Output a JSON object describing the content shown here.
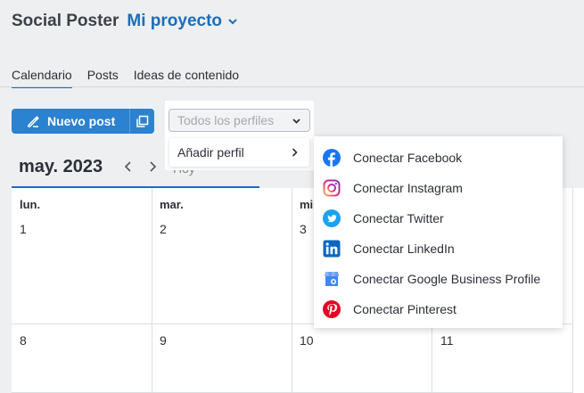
{
  "header": {
    "app_title": "Social Poster",
    "project_name": "Mi proyecto"
  },
  "tabs": [
    {
      "label": "Calendario",
      "active": true
    },
    {
      "label": "Posts",
      "active": false
    },
    {
      "label": "Ideas de contenido",
      "active": false
    }
  ],
  "toolbar": {
    "new_post_label": "Nuevo post",
    "profiles_placeholder": "Todos los perfiles",
    "add_profile_label": "Añadir perfil"
  },
  "calendar": {
    "month_label": "may. 2023",
    "today_label": "Hoy",
    "weekdays": [
      "lun.",
      "mar.",
      "mi"
    ],
    "week1_days": [
      "1",
      "2",
      "3"
    ],
    "week2_days": [
      "8",
      "9",
      "10",
      "11"
    ]
  },
  "connect_menu": {
    "items": [
      {
        "label": "Conectar Facebook",
        "icon": "facebook-icon",
        "color": "#1877f2"
      },
      {
        "label": "Conectar Instagram",
        "icon": "instagram-icon",
        "color": "#d6249f"
      },
      {
        "label": "Conectar Twitter",
        "icon": "twitter-icon",
        "color": "#1da1f2"
      },
      {
        "label": "Conectar LinkedIn",
        "icon": "linkedin-icon",
        "color": "#0a66c2"
      },
      {
        "label": "Conectar Google Business Profile",
        "icon": "google-business-icon",
        "color": "#4285f4"
      },
      {
        "label": "Conectar Pinterest",
        "icon": "pinterest-icon",
        "color": "#e60023"
      }
    ]
  },
  "colors": {
    "accent": "#1a6eb8",
    "primary_button": "#2a82d0"
  }
}
